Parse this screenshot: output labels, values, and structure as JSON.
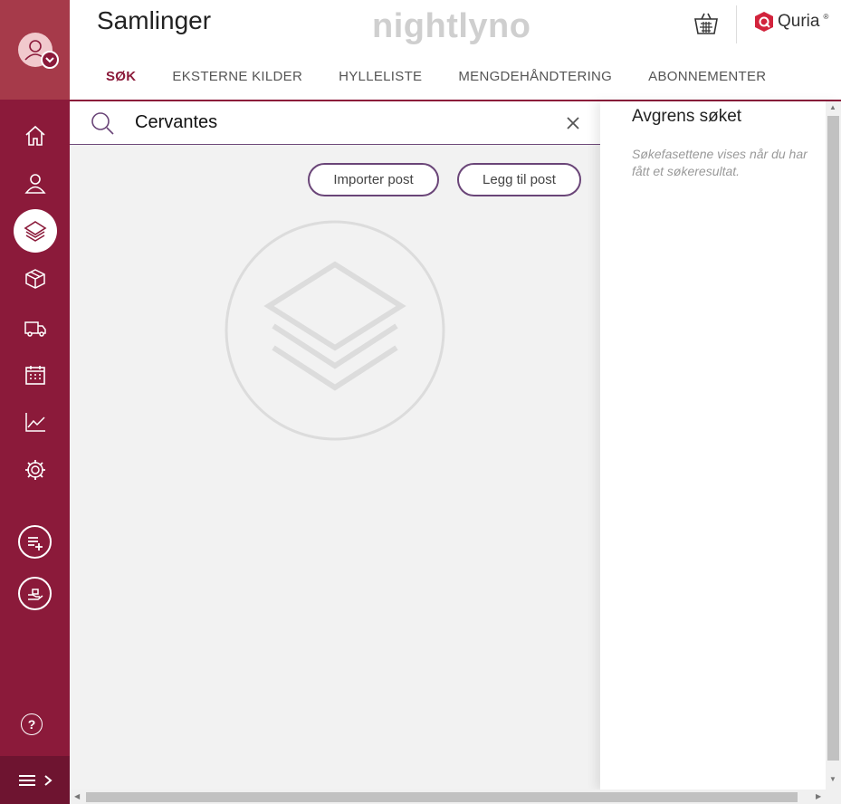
{
  "header": {
    "app_title": "Samlinger",
    "instance": "nightlyno",
    "brand": "Quria",
    "brand_mark": "®"
  },
  "tabs": [
    {
      "label": "SØK",
      "active": true
    },
    {
      "label": "EKSTERNE KILDER",
      "active": false
    },
    {
      "label": "HYLLELISTE",
      "active": false
    },
    {
      "label": "MENGDEHÅNDTERING",
      "active": false
    },
    {
      "label": "ABONNEMENTER",
      "active": false
    }
  ],
  "search": {
    "value": "Cervantes",
    "placeholder": ""
  },
  "actions": {
    "import_label": "Importer post",
    "add_label": "Legg til post"
  },
  "refine_panel": {
    "title": "Avgrens søket",
    "hint": "Søkefasettene vises når du har fått et søkeresultat."
  },
  "sidebar": {
    "items": [
      {
        "icon": "home-icon"
      },
      {
        "icon": "user-icon"
      },
      {
        "icon": "layers-icon",
        "active": true
      },
      {
        "icon": "box-icon"
      },
      {
        "icon": "truck-icon"
      },
      {
        "icon": "calendar-icon"
      },
      {
        "icon": "chart-icon"
      },
      {
        "icon": "gear-icon"
      }
    ]
  },
  "colors": {
    "sidebar": "#8b1a3a",
    "accent": "#8b1a3a",
    "button_border": "#6a4578"
  }
}
